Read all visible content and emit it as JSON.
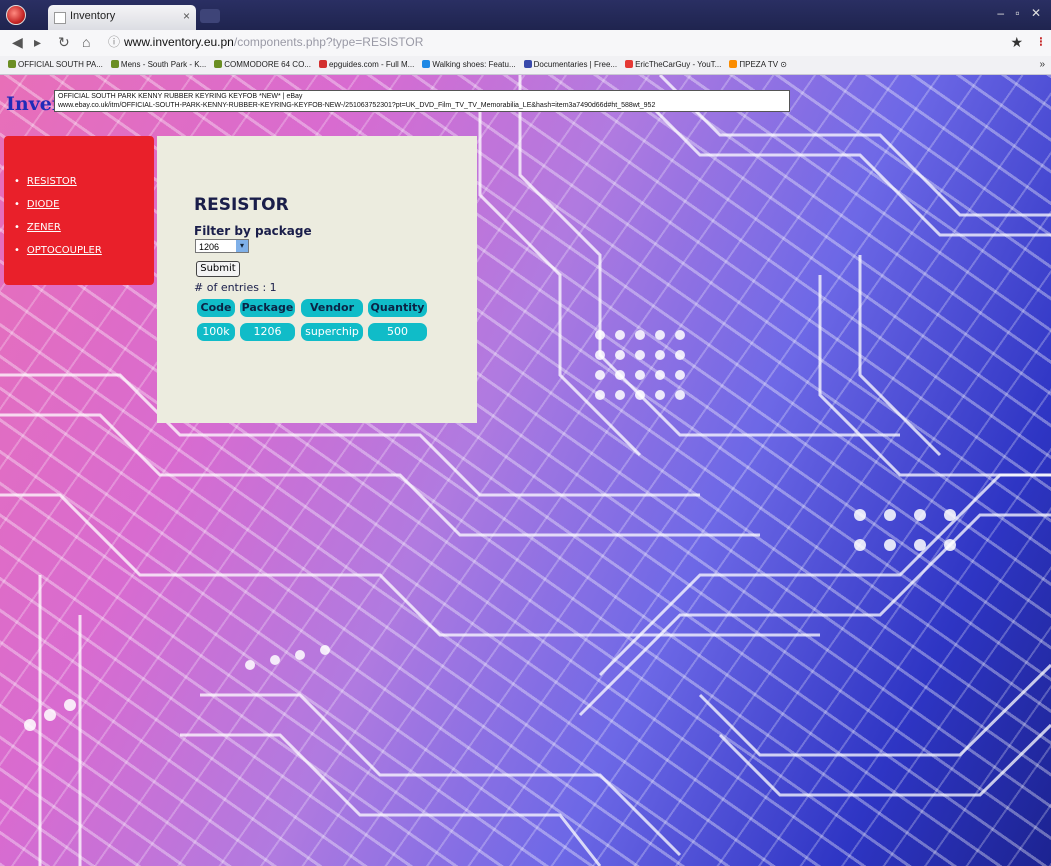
{
  "browser": {
    "tab_title": "Inventory",
    "tab_close": "×",
    "window_controls": "– ▫ ✕",
    "url_domain": "www.inventory.eu.pn",
    "url_path": "/components.php?type=RESISTOR",
    "bookmarks": [
      {
        "label": "OFFICIAL SOUTH PA...",
        "color": "#6b8e23"
      },
      {
        "label": "Mens - South Park - K...",
        "color": "#6b8e23"
      },
      {
        "label": "COMMODORE 64 CO...",
        "color": "#6b8e23"
      },
      {
        "label": "epguides.com - Full M...",
        "color": "#d32f2f"
      },
      {
        "label": "Walking shoes: Featu...",
        "color": "#1e88e5"
      },
      {
        "label": "Documentaries | Free...",
        "color": "#3949ab"
      },
      {
        "label": "EricTheCarGuy - YouT...",
        "color": "#e53935"
      },
      {
        "label": "ΠΡΕΖΑ TV ⊙",
        "color": "#fb8c00"
      }
    ],
    "bookmarks_more": "»"
  },
  "site": {
    "logo_text": "Inver",
    "tooltip_line1": "OFFICIAL SOUTH PARK KENNY RUBBER KEYRING KEYFOB *NEW* | eBay",
    "tooltip_line2": "www.ebay.co.uk/itm/OFFICIAL-SOUTH-PARK-KENNY-RUBBER-KEYRING-KEYFOB-NEW-/251063752301?pt=UK_DVD_Film_TV_TV_Memorabilia_LE&hash=item3a7490d66d#ht_588wt_952"
  },
  "sidebar": {
    "items": [
      {
        "label": "RESISTOR"
      },
      {
        "label": "DIODE"
      },
      {
        "label": "ZENER"
      },
      {
        "label": "OPTOCOUPLER"
      }
    ]
  },
  "main": {
    "heading": "RESISTOR",
    "filter_label": "Filter by package",
    "filter_value": "1206",
    "submit_label": "Submit",
    "entries_text": "# of entries : 1",
    "table": {
      "headers": [
        "Code",
        "Package",
        "Vendor",
        "Quantity"
      ],
      "rows": [
        [
          "100k",
          "1206",
          "superchip",
          "500"
        ]
      ]
    }
  },
  "colors": {
    "sidebar_bg": "#e9202a",
    "panel_bg": "#ececdf",
    "table_cell": "#10bcc8"
  }
}
